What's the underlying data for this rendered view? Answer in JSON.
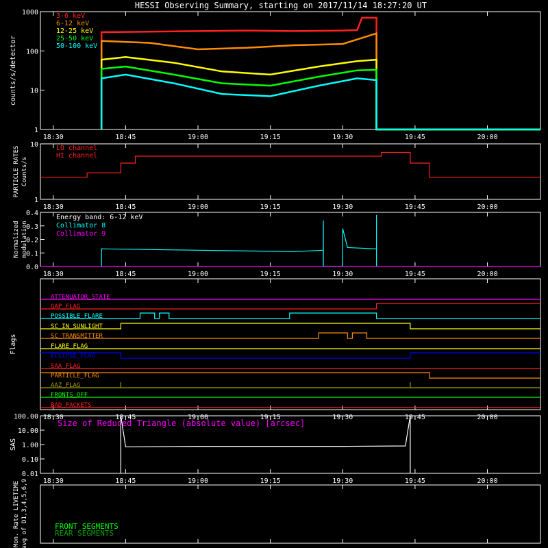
{
  "title": "HESSI Observing Summary, starting on 2017/11/14 18:27:20 UT",
  "time_ticks": [
    "18:30",
    "18:45",
    "19:00",
    "19:15",
    "19:30",
    "19:45",
    "20:00"
  ],
  "colors": {
    "background": "#000000",
    "axis": "#ffffff",
    "red": "#ff2020",
    "orange": "#ff8c00",
    "yellow": "#ffff00",
    "green": "#00ff00",
    "cyan": "#00ffff",
    "magenta": "#ff00ff",
    "blue": "#0000ff",
    "olive": "#a0a000",
    "darkgreen": "#00a000"
  },
  "chart_data": [
    {
      "id": "count_rates",
      "type": "line",
      "ylabel": "counts/s/detector",
      "yscale": "log",
      "ylim": [
        1,
        1000
      ],
      "ytick_labels": [
        "1",
        "10",
        "100",
        "1000"
      ],
      "xlim": [
        "18:27:20",
        "20:11"
      ],
      "series": [
        {
          "name": "3-6 keV",
          "color": "#ff2020",
          "x": [
            "18:40",
            "18:40",
            "18:50",
            "19:00",
            "19:10",
            "19:20",
            "19:30",
            "19:33",
            "19:34",
            "19:37",
            "19:37",
            "20:11"
          ],
          "y": [
            1,
            300,
            310,
            320,
            330,
            320,
            330,
            340,
            700,
            700,
            1,
            1
          ]
        },
        {
          "name": "6-12 keV",
          "color": "#ff8c00",
          "x": [
            "18:40",
            "18:40",
            "18:50",
            "19:00",
            "19:10",
            "19:20",
            "19:30",
            "19:37",
            "19:37",
            "20:11"
          ],
          "y": [
            1,
            180,
            160,
            110,
            120,
            140,
            150,
            280,
            1,
            1
          ]
        },
        {
          "name": "12-25 keV",
          "color": "#ffff00",
          "x": [
            "18:40",
            "18:40",
            "18:45",
            "18:55",
            "19:05",
            "19:15",
            "19:25",
            "19:33",
            "19:37",
            "19:37",
            "20:11"
          ],
          "y": [
            1,
            60,
            70,
            50,
            30,
            25,
            40,
            55,
            60,
            1,
            1
          ]
        },
        {
          "name": "25-50 keV",
          "color": "#00ff00",
          "x": [
            "18:40",
            "18:40",
            "18:45",
            "18:55",
            "19:05",
            "19:15",
            "19:25",
            "19:33",
            "19:37",
            "19:37",
            "20:11"
          ],
          "y": [
            1,
            35,
            40,
            25,
            15,
            13,
            22,
            32,
            33,
            1,
            1
          ]
        },
        {
          "name": "50-100 keV",
          "color": "#00ffff",
          "x": [
            "18:40",
            "18:40",
            "18:45",
            "18:55",
            "19:05",
            "19:15",
            "19:25",
            "19:33",
            "19:37",
            "19:37",
            "20:11"
          ],
          "y": [
            1,
            20,
            25,
            15,
            8,
            7,
            13,
            20,
            18,
            1,
            1
          ]
        }
      ]
    },
    {
      "id": "particle_rates",
      "type": "line",
      "ylabel": "PARTICLE RATES",
      "ylabel2": "Counts/s",
      "yscale": "log",
      "ylim": [
        1,
        10
      ],
      "ytick_labels": [
        "1",
        "10"
      ],
      "series": [
        {
          "name": "LO channel",
          "color": "#ff2020",
          "x": [
            "18:27:20",
            "18:37",
            "18:37",
            "18:44",
            "18:44",
            "18:47",
            "18:47",
            "19:38",
            "19:38",
            "19:44",
            "19:44",
            "19:48",
            "19:48",
            "20:11"
          ],
          "y": [
            2.5,
            2.5,
            3,
            3,
            4.5,
            4.5,
            6,
            6,
            7,
            7,
            4.5,
            4.5,
            2.5,
            2.5
          ]
        },
        {
          "name": "HI channel",
          "color": "#ff2020",
          "x": [],
          "y": []
        }
      ]
    },
    {
      "id": "modulation",
      "type": "line",
      "ylabel": "Normalized",
      "ylabel2": "modulation",
      "ylim": [
        0,
        0.4
      ],
      "ytick_labels": [
        "0.0",
        "0.1",
        "0.2",
        "0.3",
        "0.4"
      ],
      "annotation": "Energy band: 6-12 keV",
      "series": [
        {
          "name": "Collimator 8",
          "color": "#00ffff",
          "x": [
            "18:40",
            "18:40",
            "19:00",
            "19:20",
            "19:26",
            "19:26",
            "19:26",
            "19:26",
            "19:30",
            "19:30",
            "19:31",
            "19:37",
            "19:37",
            "19:37"
          ],
          "y": [
            0,
            0.13,
            0.12,
            0.11,
            0.12,
            0.34,
            0.0,
            0.0,
            0.0,
            0.28,
            0.14,
            0.13,
            0.38,
            0.0
          ]
        },
        {
          "name": "Collimator 9",
          "color": "#ff00ff",
          "x": [
            "18:27:20",
            "20:11"
          ],
          "y": [
            0,
            0
          ]
        }
      ]
    },
    {
      "id": "flags",
      "type": "line",
      "ylabel": "Flags",
      "series": [
        {
          "name": "ATTENUATOR_STATE",
          "color": "#ff00ff",
          "x": [
            "18:27:20",
            "20:11"
          ],
          "y": [
            0,
            0
          ]
        },
        {
          "name": "GAP_FLAG",
          "color": "#ff2020",
          "x": [
            "18:27:20",
            "19:37",
            "19:37",
            "20:11"
          ],
          "y": [
            0,
            0,
            1,
            1
          ]
        },
        {
          "name": "POSSIBLE_FLARE",
          "color": "#00ffff",
          "x": [
            "18:27:20",
            "18:48",
            "18:48",
            "18:51",
            "18:51",
            "18:52",
            "18:52",
            "18:54",
            "18:54",
            "19:19",
            "19:19",
            "19:37",
            "19:37",
            "20:11"
          ],
          "y": [
            0,
            0,
            1,
            1,
            0,
            0,
            1,
            1,
            0,
            0,
            1,
            1,
            0,
            0
          ]
        },
        {
          "name": "SC_IN_SUNLIGHT",
          "color": "#ffff00",
          "x": [
            "18:27:20",
            "18:44",
            "18:44",
            "19:44",
            "19:44",
            "20:11"
          ],
          "y": [
            0,
            0,
            1,
            1,
            0,
            0
          ]
        },
        {
          "name": "SC_TRANSMITTER",
          "color": "#ff8c00",
          "x": [
            "18:27:20",
            "19:25",
            "19:25",
            "19:31",
            "19:31",
            "19:32",
            "19:32",
            "19:35",
            "19:35",
            "20:11"
          ],
          "y": [
            0,
            0,
            1,
            1,
            0,
            0,
            1,
            1,
            0,
            0
          ]
        },
        {
          "name": "FLARE_FLAG",
          "color": "#ffff00",
          "x": [
            "18:27:20",
            "20:11"
          ],
          "y": [
            0,
            0
          ]
        },
        {
          "name": "ECLIPSE_FLAG",
          "color": "#0000ff",
          "x": [
            "18:27:20",
            "18:44",
            "18:44",
            "19:44",
            "19:44",
            "20:11"
          ],
          "y": [
            1,
            1,
            0,
            0,
            1,
            1
          ]
        },
        {
          "name": "SAA_FLAG",
          "color": "#ff2020",
          "x": [
            "18:27:20",
            "20:11"
          ],
          "y": [
            0,
            0
          ]
        },
        {
          "name": "PARTICLE_FLAG",
          "color": "#ff8c00",
          "x": [
            "18:27:20",
            "19:48",
            "19:48",
            "20:11"
          ],
          "y": [
            1,
            1,
            0,
            0
          ]
        },
        {
          "name": "AAZ_FLAG",
          "color": "#a0a000",
          "x": [
            "18:27:20",
            "18:44",
            "18:44",
            "18:44",
            "18:44",
            "19:44",
            "19:44",
            "19:44",
            "19:44",
            "20:11"
          ],
          "y": [
            0,
            0,
            1,
            1,
            0,
            0,
            1,
            1,
            0,
            0
          ]
        },
        {
          "name": "FRONTS_OFF",
          "color": "#00ff00",
          "x": [
            "18:27:20",
            "20:11"
          ],
          "y": [
            0,
            0
          ]
        },
        {
          "name": "BAD_PACKETS",
          "color": "#ff2020",
          "x": [
            "18:27:20",
            "20:11"
          ],
          "y": [
            0,
            0
          ]
        }
      ]
    },
    {
      "id": "sas",
      "type": "line",
      "ylabel": "SAS",
      "yscale": "log",
      "ylim": [
        0.01,
        100
      ],
      "ytick_labels": [
        "0.01",
        "0.10",
        "1.00",
        "10.00",
        "100.00"
      ],
      "annotation": "Size of Reduced Triangle (absolute value) [arcsec]",
      "series": [
        {
          "name": "SAS",
          "color": "#ffffff",
          "x": [
            "18:44",
            "18:44",
            "18:45",
            "19:00",
            "19:15",
            "19:30",
            "19:43",
            "19:44",
            "19:44"
          ],
          "y": [
            0.01,
            100,
            0.7,
            0.75,
            0.75,
            0.75,
            0.8,
            100,
            0.01
          ]
        }
      ]
    },
    {
      "id": "livetime",
      "type": "line",
      "ylabel": "Mon. Rate LIVETIME",
      "ylabel2": "avg of D1,3,4,5,6,9",
      "series": [
        {
          "name": "FRONT SEGMENTS",
          "color": "#00ff00",
          "x": [],
          "y": []
        },
        {
          "name": "REAR SEGMENTS",
          "color": "#00a000",
          "x": [],
          "y": []
        }
      ]
    }
  ]
}
